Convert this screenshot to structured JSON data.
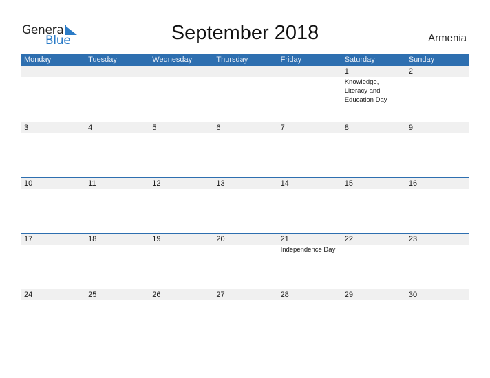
{
  "logo": {
    "line1": "General",
    "line2": "Blue"
  },
  "title": "September 2018",
  "country": "Armenia",
  "colors": {
    "header_bg": "#2e6fb0",
    "accent": "#2a7bc7",
    "strip": "#f0f0f0"
  },
  "weekdays": [
    "Monday",
    "Tuesday",
    "Wednesday",
    "Thursday",
    "Friday",
    "Saturday",
    "Sunday"
  ],
  "weeks": [
    [
      {
        "day": ""
      },
      {
        "day": ""
      },
      {
        "day": ""
      },
      {
        "day": ""
      },
      {
        "day": ""
      },
      {
        "day": "1",
        "event": "Knowledge, Literacy and Education Day"
      },
      {
        "day": "2"
      }
    ],
    [
      {
        "day": "3"
      },
      {
        "day": "4"
      },
      {
        "day": "5"
      },
      {
        "day": "6"
      },
      {
        "day": "7"
      },
      {
        "day": "8"
      },
      {
        "day": "9"
      }
    ],
    [
      {
        "day": "10"
      },
      {
        "day": "11"
      },
      {
        "day": "12"
      },
      {
        "day": "13"
      },
      {
        "day": "14"
      },
      {
        "day": "15"
      },
      {
        "day": "16"
      }
    ],
    [
      {
        "day": "17"
      },
      {
        "day": "18"
      },
      {
        "day": "19"
      },
      {
        "day": "20"
      },
      {
        "day": "21",
        "event": "Independence Day"
      },
      {
        "day": "22"
      },
      {
        "day": "23"
      }
    ],
    [
      {
        "day": "24"
      },
      {
        "day": "25"
      },
      {
        "day": "26"
      },
      {
        "day": "27"
      },
      {
        "day": "28"
      },
      {
        "day": "29"
      },
      {
        "day": "30"
      }
    ]
  ]
}
